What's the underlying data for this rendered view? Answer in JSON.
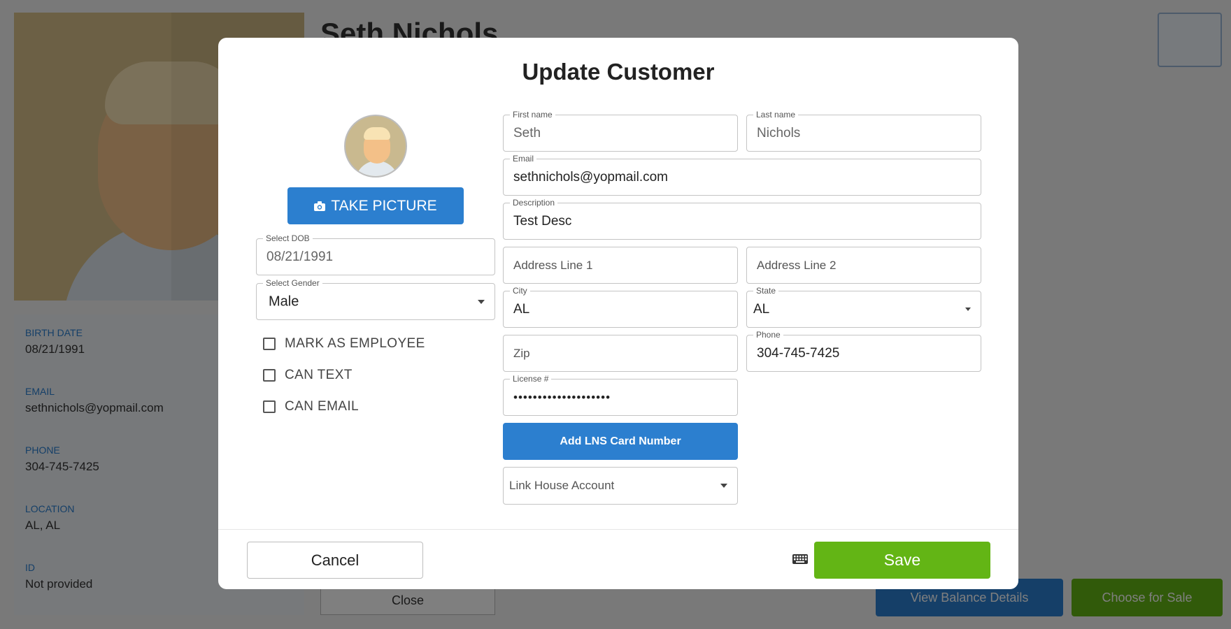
{
  "background": {
    "customer_name": "Seth Nichols",
    "info": [
      {
        "label": "BIRTH DATE",
        "value": "08/21/1991"
      },
      {
        "label": "EMAIL",
        "value": "sethnichols@yopmail.com"
      },
      {
        "label": "PHONE",
        "value": "304-745-7425"
      },
      {
        "label": "LOCATION",
        "value": "AL, AL"
      },
      {
        "label": "ID",
        "value": "Not provided"
      }
    ],
    "close_label": "Close",
    "view_balance_label": "View Balance Details",
    "choose_sale_label": "Choose for Sale"
  },
  "modal": {
    "title": "Update Customer",
    "take_picture_label": "TAKE PICTURE",
    "dob": {
      "label": "Select DOB",
      "value": "08/21/1991"
    },
    "gender": {
      "label": "Select Gender",
      "value": "Male"
    },
    "checkboxes": [
      {
        "label": "MARK AS EMPLOYEE",
        "checked": false
      },
      {
        "label": "CAN TEXT",
        "checked": false
      },
      {
        "label": "CAN EMAIL",
        "checked": false
      }
    ],
    "first_name": {
      "label": "First name",
      "value": "Seth"
    },
    "last_name": {
      "label": "Last name",
      "value": "Nichols"
    },
    "email": {
      "label": "Email",
      "value": "sethnichols@yopmail.com"
    },
    "description": {
      "label": "Description",
      "value": "Test Desc"
    },
    "address1": {
      "placeholder": "Address Line 1"
    },
    "address2": {
      "placeholder": "Address Line 2"
    },
    "city": {
      "label": "City",
      "value": "AL"
    },
    "state": {
      "label": "State",
      "value": "AL"
    },
    "zip": {
      "placeholder": "Zip"
    },
    "phone": {
      "label": "Phone",
      "value": "304-745-7425"
    },
    "license": {
      "label": "License #",
      "value": "••••••••••••••••••••"
    },
    "add_lns_label": "Add LNS Card Number",
    "link_house_account": {
      "placeholder": "Link House Account"
    },
    "cancel_label": "Cancel",
    "save_label": "Save"
  },
  "colors": {
    "primary_blue": "#2c7fcf",
    "save_green": "#63b515",
    "overlay": "rgba(0,0,0,0.5)"
  },
  "icons": {
    "camera": "camera-icon",
    "dropdown": "caret-down-icon",
    "keyboard": "keyboard-icon"
  }
}
